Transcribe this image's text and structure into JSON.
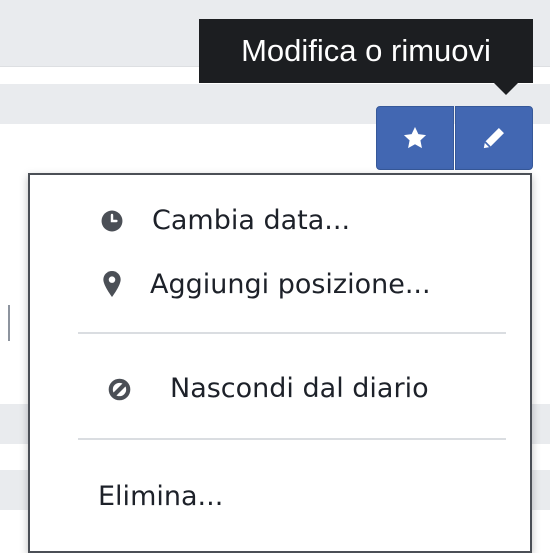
{
  "tooltip": {
    "text": "Modifica o rimuovi"
  },
  "toolbar": {
    "favorite_icon": "star-icon",
    "edit_icon": "pencil-icon",
    "accent_color": "#4267b2"
  },
  "menu": {
    "items": [
      {
        "label": "Cambia data...",
        "icon": "clock-icon"
      },
      {
        "label": "Aggiungi posizione...",
        "icon": "location-pin-icon"
      },
      {
        "label": "Nascondi dal diario",
        "icon": "hide-icon"
      },
      {
        "label": "Elimina...",
        "icon": null
      }
    ]
  }
}
